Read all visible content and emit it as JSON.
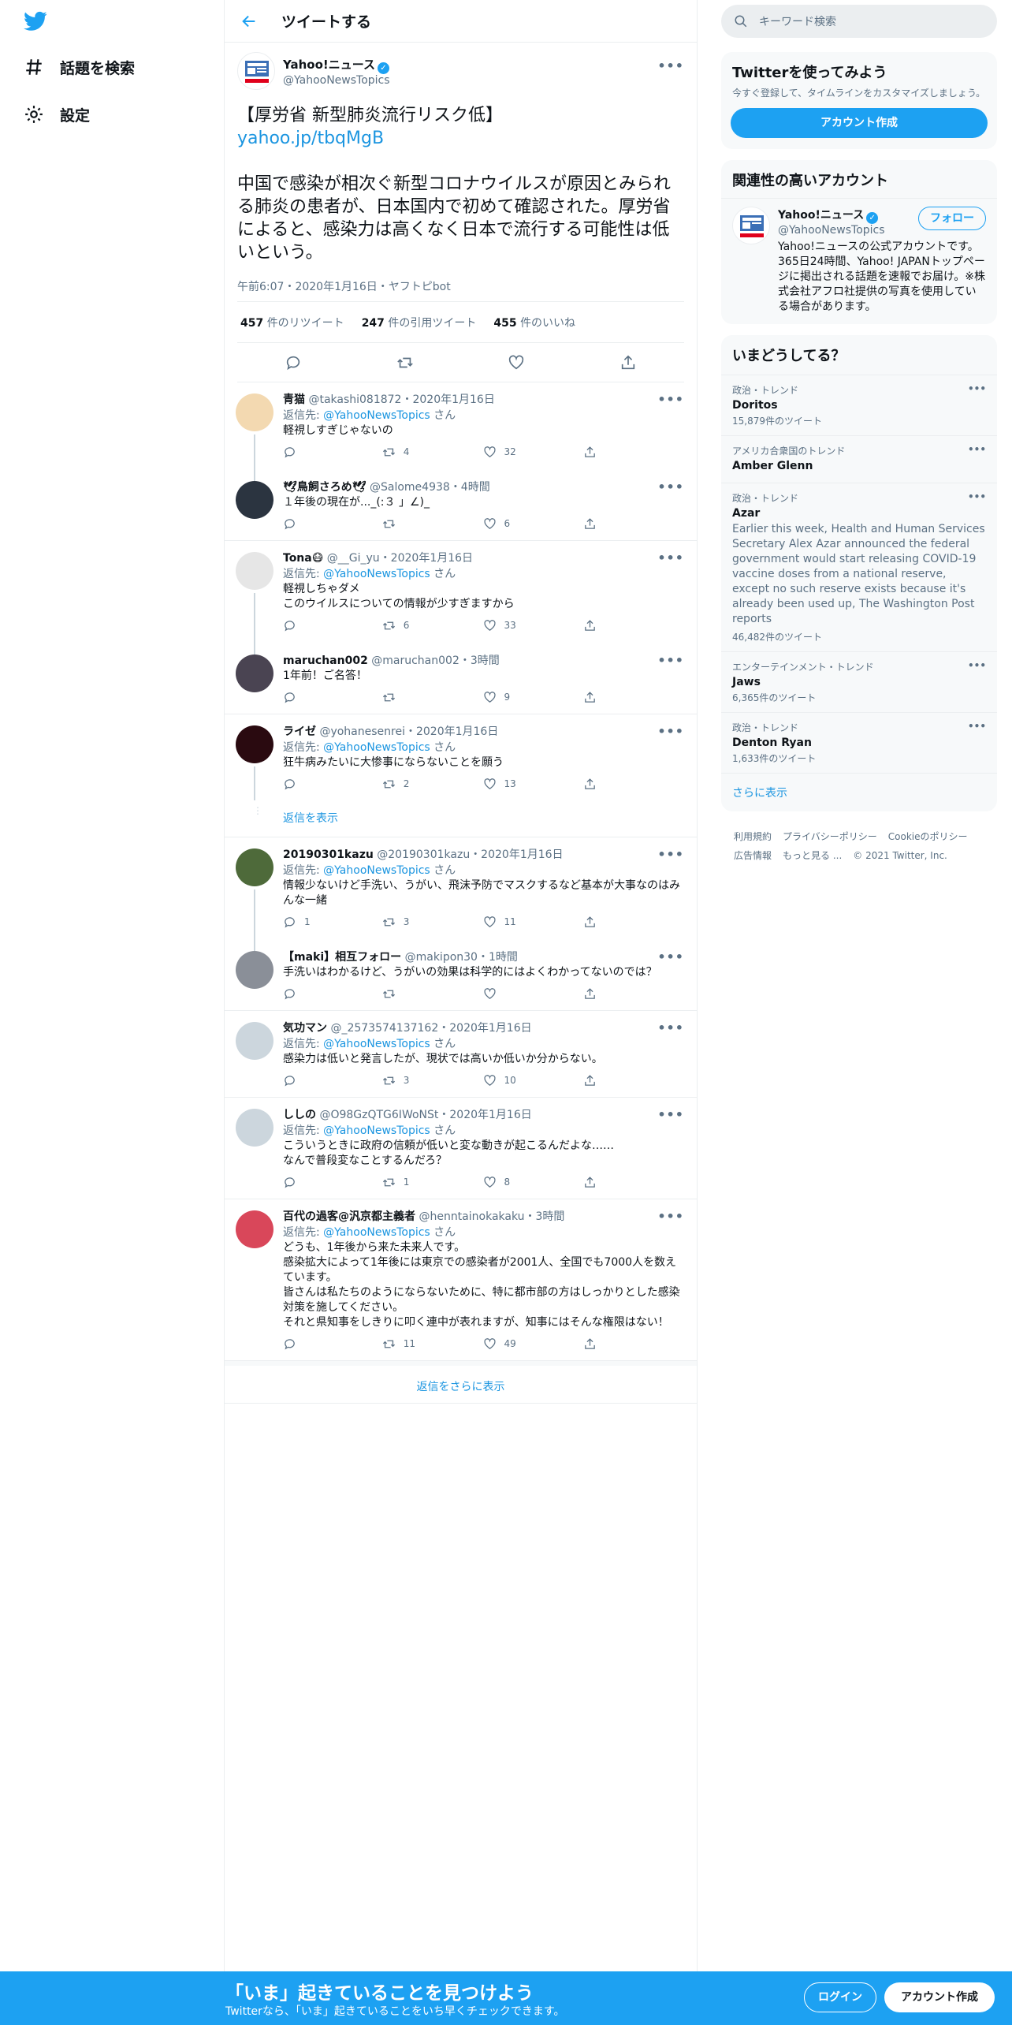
{
  "nav": {
    "explore": "話題を検索",
    "settings": "設定"
  },
  "header": {
    "title": "ツイートする"
  },
  "tweet": {
    "name": "Yahoo!ニュース",
    "handle": "@YahooNewsTopics",
    "headline": "【厚労省 新型肺炎流行リスク低】",
    "link": "yahoo.jp/tbqMgB",
    "body": "中国で感染が相次ぐ新型コロナウイルスが原因とみられる肺炎の患者が、日本国内で初めて確認された。厚労省によると、感染力は高くなく日本で流行する可能性は低いという。",
    "meta": "午前6:07・2020年1月16日・ヤフトピbot",
    "retweets_n": "457",
    "retweets_label": "件のリツイート",
    "quotes_n": "247",
    "quotes_label": "件の引用ツイート",
    "likes_n": "455",
    "likes_label": "件のいいね"
  },
  "reply_prefix": "返信先:",
  "reply_suffix": "さん",
  "replies": [
    {
      "name": "青猫",
      "handle": "@takashi081872",
      "date": "・2020年1月16日",
      "reply_to": "@YahooNewsTopics",
      "text": "軽視しすぎじゃないの",
      "rt": "4",
      "like": "32",
      "avatar_color": "#f3d9b1"
    },
    {
      "name": "🕊鳥飼さろめ🕊",
      "handle": "@Salome4938",
      "date": "・4時間",
      "text": "１年後の現在が..._(:３ 」∠)_",
      "rt": "",
      "like": "6",
      "avatar_color": "#2b3440"
    },
    {
      "name": "Tona😷",
      "handle": "@__Gi_yu",
      "date": "・2020年1月16日",
      "reply_to": "@YahooNewsTopics",
      "text": "軽視しちゃダメ\nこのウイルスについての情報が少すぎますから",
      "rt": "6",
      "like": "33",
      "avatar_color": "#e6e6e6"
    },
    {
      "name": "maruchan002",
      "handle": "@maruchan002",
      "date": "・3時間",
      "text": "1年前！ご名答！",
      "rt": "",
      "like": "9",
      "avatar_color": "#4a4452"
    },
    {
      "name": "ライゼ",
      "handle": "@yohanesenrei",
      "date": "・2020年1月16日",
      "reply_to": "@YahooNewsTopics",
      "text": "狂牛病みたいに大惨事にならないことを願う",
      "rt": "2",
      "like": "13",
      "avatar_color": "#2a0a10"
    },
    {
      "name": "20190301kazu",
      "handle": "@20190301kazu",
      "date": "・2020年1月16日",
      "reply_to": "@YahooNewsTopics",
      "text": "情報少ないけど手洗い、うがい、飛沫予防でマスクするなど基本が大事なのはみんな一緒",
      "reply": "1",
      "rt": "3",
      "like": "11",
      "avatar_color": "#4e6a3a"
    },
    {
      "name": "【maki】相互フォロー",
      "handle": "@makipon30",
      "date": "・1時間",
      "text": "手洗いはわかるけど、うがいの効果は科学的にはよくわかってないのでは？",
      "rt": "",
      "like": "",
      "avatar_color": "#8a8f98"
    },
    {
      "name": "気功マン",
      "handle": "@_2573574137162",
      "date": "・2020年1月16日",
      "reply_to": "@YahooNewsTopics",
      "text": "感染力は低いと発言したが、現状では高いか低いか分からない。",
      "rt": "3",
      "like": "10",
      "avatar_color": "#ccd6dd"
    },
    {
      "name": "ししの",
      "handle": "@O98GzQTG6IWoNSt",
      "date": "・2020年1月16日",
      "reply_to": "@YahooNewsTopics",
      "text": "こういうときに政府の信頼が低いと変な動きが起こるんだよな……\nなんで普段変なことするんだろ？",
      "rt": "1",
      "like": "8",
      "avatar_color": "#ccd6dd"
    },
    {
      "name": "百代の過客@汎京都主義者",
      "handle": "@henntainokakaku",
      "date": "・3時間",
      "reply_to": "@YahooNewsTopics",
      "text": "どうも、1年後から来た未来人です。\n感染拡大によって1年後には東京での感染者が2001人、全国でも7000人を数えています。\n皆さんは私たちのようにならないために、特に都市部の方はしっかりとした感染対策を施してください。\nそれと県知事をしきりに叩く連中が表れますが、知事にはそんな権限はない！",
      "rt": "11",
      "like": "49",
      "avatar_color": "#d9475a"
    }
  ],
  "show_replies": "返信を表示",
  "more_replies": "返信をさらに表示",
  "right": {
    "search_placeholder": "キーワード検索",
    "try_title": "Twitterを使ってみよう",
    "try_sub": "今すぐ登録して、タイムラインをカスタマイズしましょう。",
    "signup": "アカウント作成",
    "rel_title": "関連性の高いアカウント",
    "rel_name": "Yahoo!ニュース",
    "rel_handle": "@YahooNewsTopics",
    "rel_follow": "フォロー",
    "rel_bio": "Yahoo!ニュースの公式アカウントです。365日24時間、Yahoo! JAPANトップページに掲出される話題を速報でお届け。※株式会社アフロ社提供の写真を使用している場合があります。",
    "trends_title": "いまどうしてる？",
    "trends": [
      {
        "cat": "政治・トレンド",
        "title": "Doritos",
        "count": "15,879件のツイート"
      },
      {
        "cat": "アメリカ合衆国のトレンド",
        "title": "Amber Glenn"
      },
      {
        "cat": "政治・トレンド",
        "title": "Azar",
        "desc": "Earlier this week, Health and Human Services Secretary Alex Azar announced the federal government would start releasing COVID-19 vaccine doses from a national reserve, except no such reserve exists because it's already been used up, The Washington Post reports",
        "count": "46,482件のツイート"
      },
      {
        "cat": "エンターテインメント・トレンド",
        "title": "Jaws",
        "count": "6,365件のツイート"
      },
      {
        "cat": "政治・トレンド",
        "title": "Denton Ryan",
        "count": "1,633件のツイート"
      }
    ],
    "show_more": "さらに表示",
    "footer": [
      "利用規約",
      "プライバシーポリシー",
      "Cookieのポリシー",
      "広告情報",
      "もっと見る ...",
      "© 2021 Twitter, Inc."
    ]
  },
  "bottom": {
    "headline": "「いま」起きていることを見つけよう",
    "sub": "Twitterなら、「いま」起きていることをいち早くチェックできます。",
    "login": "ログイン",
    "signup": "アカウント作成"
  },
  "colors": {
    "accent": "#1da1f2",
    "link": "#1b95e0"
  }
}
